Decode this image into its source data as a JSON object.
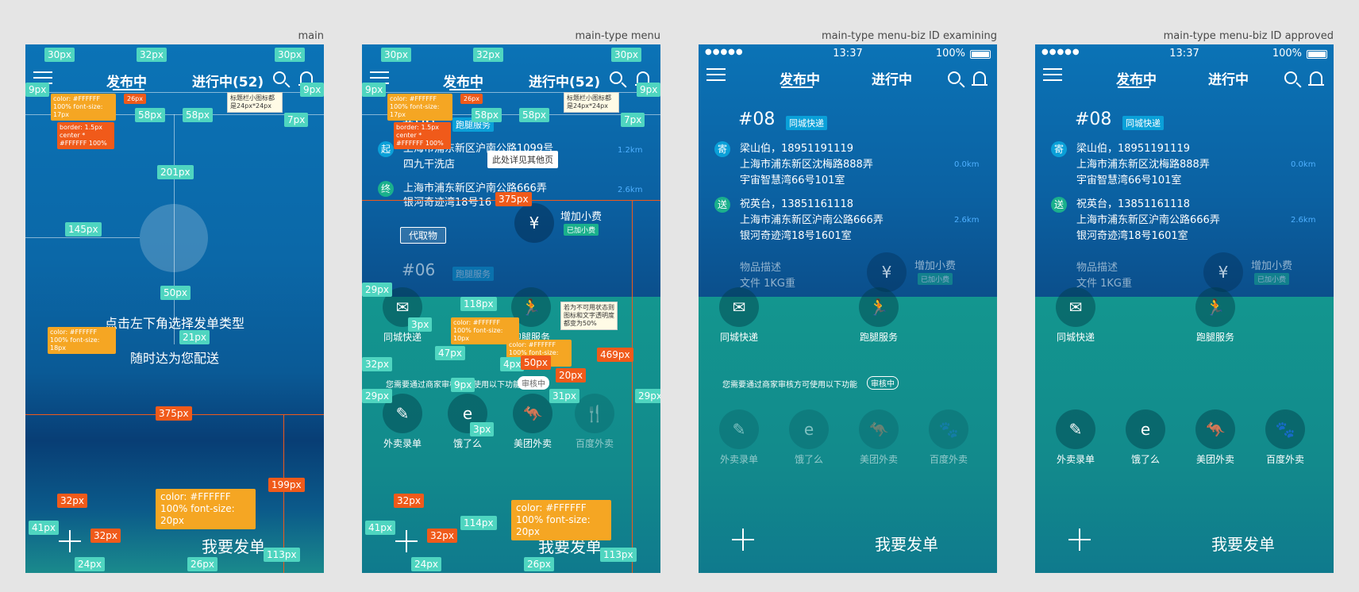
{
  "captions": [
    "main",
    "main-type menu",
    "main-type menu-biz ID examining",
    "main-type menu-biz ID approved"
  ],
  "status": {
    "time": "13:37",
    "battery": "100%",
    "signal": "●●●●●"
  },
  "header": {
    "tab_active": "发布中",
    "tab_progress_count": "进行中(52)",
    "tab_progress": "进行中"
  },
  "main": {
    "hint1": "点击左下角选择发单类型",
    "hint2": "随时达为您配送",
    "cta": "我要发单"
  },
  "order": {
    "id": "#08",
    "tag": "同城快递",
    "id_prev": "#06",
    "tag_prev": "跑腿服务",
    "sender": "梁山伯，18951191119",
    "sender_addr1": "上海市浦东新区沈梅路888弄",
    "sender_addr2": "宇宙智慧湾66号101室",
    "sender_dist": "0.0km",
    "receiver": "祝英台，13851161118",
    "receiver_addr1": "上海市浦东新区沪南公路666弄",
    "receiver_addr2": "银河奇迹湾18号1601室",
    "receiver_dist": "2.6km",
    "goods_label": "物品描述",
    "goods_value": "文件 1KG重",
    "tip_label": "增加小费",
    "tip_badge": "已加小费",
    "start_badge": "起",
    "end_badge": "终",
    "send_badge": "寄",
    "recv_badge": "送",
    "start_addr1": "上海市浦东新区沪南公路1099号",
    "start_addr2": "四九干洗店",
    "start_dist": "1.2km",
    "end_addr1": "上海市浦东新区沪南公路666弄",
    "end_addr2": "银河奇迹湾18号16",
    "end_dist": "2.6km",
    "pickup_btn": "代取物"
  },
  "menu": {
    "items_top": [
      {
        "label": "同城快递",
        "icon": "envelope-icon"
      },
      {
        "label": "跑腿服务",
        "icon": "runner-icon"
      }
    ],
    "notice": "您需要通过商家审核方可使用以下功能",
    "notice_badge": "审核中",
    "items_biz": [
      {
        "label": "外卖录单",
        "icon": "form-icon"
      },
      {
        "label": "饿了么",
        "icon": "eleme-icon"
      },
      {
        "label": "美团外卖",
        "icon": "kangaroo-icon"
      },
      {
        "label": "百度外卖",
        "icon": "baidu-icon"
      }
    ]
  },
  "annotations": {
    "m30": "30px",
    "m32": "32px",
    "m9": "9px",
    "m58": "58px",
    "m7": "7px",
    "m201": "201px",
    "m145": "145px",
    "m50": "50px",
    "m21": "21px",
    "m375": "375px",
    "m199": "199px",
    "m41": "41px",
    "m24": "24px",
    "m26": "26px",
    "m113": "113px",
    "m26r": "26px",
    "a_title": "color: #FFFFFF 100% font-size: 17px",
    "a_border": "border: 1.5px center * #FFFFFF 100%",
    "a_hint": "color: #FFFFFF 100% font-size: 18px",
    "a_btn": "color: #FFFFFF 100% font-size: 20px",
    "a_icon_note": "标题栏小图标都是24px*24px",
    "n_detail": "此处详见其他页",
    "m29": "29px",
    "m118": "118px",
    "m3": "3px",
    "m47": "47px",
    "m4": "4px",
    "m50o": "50px",
    "m20": "20px",
    "m469": "469px",
    "m31": "31px",
    "m114": "114px",
    "a_menu10": "color: #FFFFFF 100% font-size: 10px",
    "a_menu12": "color: #FFFFFF 100% font-size: 12px",
    "n_disabled": "若为不可用状态则图标和文字透明度都变为50%"
  }
}
